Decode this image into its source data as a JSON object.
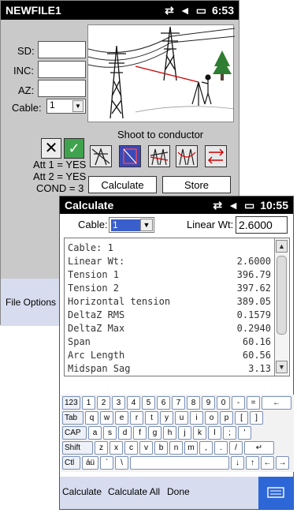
{
  "main_window": {
    "title": "NEWFILE1",
    "clock": "6:53",
    "icons": [
      "connectivity-icon",
      "volume-icon",
      "battery-icon"
    ],
    "fields": [
      {
        "label": "SD:",
        "value": ""
      },
      {
        "label": "INC:",
        "value": ""
      },
      {
        "label": "AZ:",
        "value": ""
      }
    ],
    "cable_label": "Cable:",
    "cable_value": "1",
    "shoot_label": "Shoot to conductor",
    "att1": "Att 1 = YES",
    "att2": "Att 2 = YES",
    "cond": "COND = 3",
    "calculate_label": "Calculate",
    "store_label": "Store",
    "menu_label": "File Options"
  },
  "calc_window": {
    "title": "Calculate",
    "clock": "10:55",
    "cable_label": "Cable:",
    "cable_value": "1",
    "linear_wt_label": "Linear Wt:",
    "linear_wt_value": "2.6000",
    "results": [
      {
        "k": "Cable: 1",
        "v": ""
      },
      {
        "k": "Linear Wt:",
        "v": "2.6000"
      },
      {
        "k": "Tension 1",
        "v": "396.79"
      },
      {
        "k": "Tension 2",
        "v": "397.62"
      },
      {
        "k": "Horizontal tension",
        "v": "389.05"
      },
      {
        "k": "DeltaZ RMS",
        "v": "0.1579"
      },
      {
        "k": "DeltaZ Max",
        "v": "0.2940"
      },
      {
        "k": "Span",
        "v": "60.16"
      },
      {
        "k": "Arc Length",
        "v": "60.56"
      },
      {
        "k": "Midspan Sag",
        "v": "3.13"
      }
    ],
    "menu": {
      "calculate": "Calculate",
      "calculate_all": "Calculate All",
      "done": "Done"
    }
  },
  "keyboard": {
    "row1": [
      "123",
      "1",
      "2",
      "3",
      "4",
      "5",
      "6",
      "7",
      "8",
      "9",
      "0",
      "-",
      "=",
      "←"
    ],
    "row2": [
      "Tab",
      "q",
      "w",
      "e",
      "r",
      "t",
      "y",
      "u",
      "i",
      "o",
      "p",
      "[",
      "]"
    ],
    "row3": [
      "CAP",
      "a",
      "s",
      "d",
      "f",
      "g",
      "h",
      "j",
      "k",
      "l",
      ";",
      "'"
    ],
    "row4": [
      "Shift",
      "z",
      "x",
      "c",
      "v",
      "b",
      "n",
      "m",
      ",",
      ".",
      "/",
      "↵"
    ],
    "row5": [
      "Ctl",
      "áü",
      "`",
      "\\",
      "",
      "↓",
      "↑",
      "←",
      "→"
    ]
  }
}
